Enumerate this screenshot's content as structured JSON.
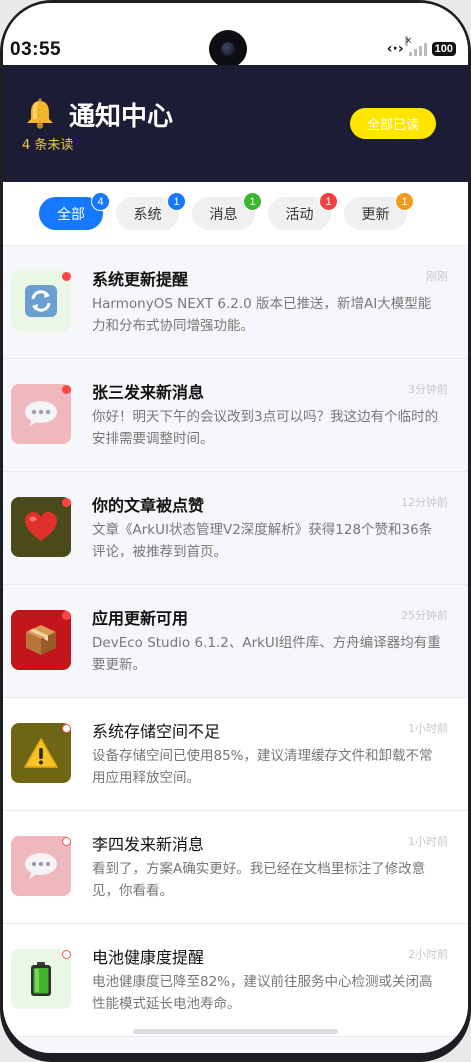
{
  "status_bar": {
    "time": "03:55",
    "battery": "100"
  },
  "header": {
    "title": "通知中心",
    "unread": "4 条未读",
    "read_all_label": "全部已读"
  },
  "tabs": [
    {
      "label": "全部",
      "badge": "4",
      "badge_color": "#1677ff",
      "active": true
    },
    {
      "label": "系统",
      "badge": "1",
      "badge_color": "#1677ff",
      "active": false
    },
    {
      "label": "消息",
      "badge": "1",
      "badge_color": "#3cb62e",
      "active": false
    },
    {
      "label": "活动",
      "badge": "1",
      "badge_color": "#f44040",
      "active": false
    },
    {
      "label": "更新",
      "badge": "1",
      "badge_color": "#f39a1b",
      "active": false
    }
  ],
  "notifications": [
    {
      "title": "系统更新提醒",
      "time": "刚刚",
      "desc": "HarmonyOS NEXT 6.2.0 版本已推送，新增AI大模型能力和分布式协同增强功能。",
      "icon": "sync-icon",
      "icon_bg": "#e9f7e4",
      "unread": true
    },
    {
      "title": "张三发来新消息",
      "time": "3分钟前",
      "desc": "你好！明天下午的会议改到3点可以吗？我这边有个临时的安排需要调整时间。",
      "icon": "chat-bubble-icon",
      "icon_bg": "#efb8bc",
      "unread": true
    },
    {
      "title": "你的文章被点赞",
      "time": "12分钟前",
      "desc": "文章《ArkUI状态管理V2深度解析》获得128个赞和36条评论，被推荐到首页。",
      "icon": "heart-icon",
      "icon_bg": "#4a4a1a",
      "unread": true
    },
    {
      "title": "应用更新可用",
      "time": "25分钟前",
      "desc": "DevEco Studio 6.1.2、ArkUI组件库、方舟编译器均有重要更新。",
      "icon": "package-icon",
      "icon_bg": "#c3161c",
      "unread": true
    },
    {
      "title": "系统存储空间不足",
      "time": "1小时前",
      "desc": "设备存储空间已使用85%，建议清理缓存文件和卸载不常用应用释放空间。",
      "icon": "warning-icon",
      "icon_bg": "#6e6614",
      "unread": false
    },
    {
      "title": "李四发来新消息",
      "time": "1小时前",
      "desc": "看到了，方案A确实更好。我已经在文档里标注了修改意见，你看看。",
      "icon": "chat-bubble-icon",
      "icon_bg": "#efb8bc",
      "unread": false
    },
    {
      "title": "电池健康度提醒",
      "time": "2小时前",
      "desc": "电池健康度已降至82%，建议前往服务中心检测或关闭高性能模式延长电池寿命。",
      "icon": "battery-icon",
      "icon_bg": "#e9f7e4",
      "unread": false
    }
  ]
}
